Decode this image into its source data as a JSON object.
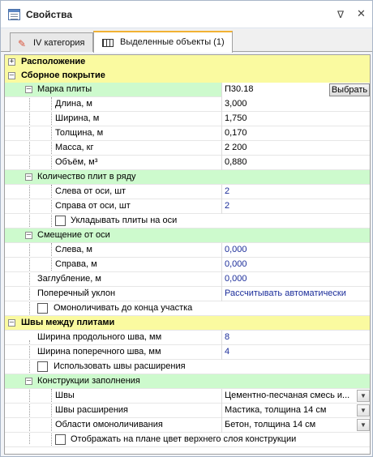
{
  "panel": {
    "title": "Свойства",
    "pin_icon": "pin-icon",
    "close_icon": "close-icon"
  },
  "tabs": [
    {
      "label": "IV категория",
      "icon": "pencil-icon"
    },
    {
      "label": "Выделенные объекты (1)",
      "icon": "grid-icon",
      "active": true
    }
  ],
  "rows": {
    "location": {
      "label": "Расположение"
    },
    "assembled": {
      "label": "Сборное покрытие"
    },
    "slab_brand": {
      "label": "Марка плиты",
      "value": "П30.18",
      "button": "Выбрать"
    },
    "length": {
      "label": "Длина, м",
      "value": "3,000"
    },
    "width": {
      "label": "Ширина, м",
      "value": "1,750"
    },
    "thickness": {
      "label": "Толщина, м",
      "value": "0,170"
    },
    "mass": {
      "label": "Масса, кг",
      "value": "2 200"
    },
    "volume": {
      "label": "Объём, м³",
      "value": "0,880"
    },
    "slab_count": {
      "label": "Количество плит в ряду"
    },
    "left_count": {
      "label": "Слева от оси, шт",
      "value": "2"
    },
    "right_count": {
      "label": "Справа от оси, шт",
      "value": "2"
    },
    "lay_on_axis": {
      "label": "Укладывать плиты на оси"
    },
    "offset": {
      "label": "Смещение от оси"
    },
    "offset_left": {
      "label": "Слева, м",
      "value": "0,000"
    },
    "offset_right": {
      "label": "Справа, м",
      "value": "0,000"
    },
    "depth": {
      "label": "Заглубление, м",
      "value": "0,000"
    },
    "cross_slope": {
      "label": "Поперечный уклон",
      "value": "Рассчитывать автоматически"
    },
    "monolith_end": {
      "label": "Омоноличивать до конца участка"
    },
    "seams": {
      "label": "Швы между плитами"
    },
    "long_seam": {
      "label": "Ширина продольного шва, мм",
      "value": "8"
    },
    "cross_seam": {
      "label": "Ширина поперечного шва, мм",
      "value": "4"
    },
    "use_exp_seams": {
      "label": "Использовать швы расширения"
    },
    "fill": {
      "label": "Конструкции заполнения"
    },
    "fill_seams": {
      "label": "Швы",
      "value": "Цементно-песчаная смесь и..."
    },
    "fill_exp": {
      "label": "Швы расширения",
      "value": "Мастика, толщина 14 см"
    },
    "fill_mono": {
      "label": "Области омоноличивания",
      "value": "Бетон, толщина 14 см"
    },
    "show_color": {
      "label": "Отображать на плане цвет верхнего слоя конструкции"
    }
  }
}
